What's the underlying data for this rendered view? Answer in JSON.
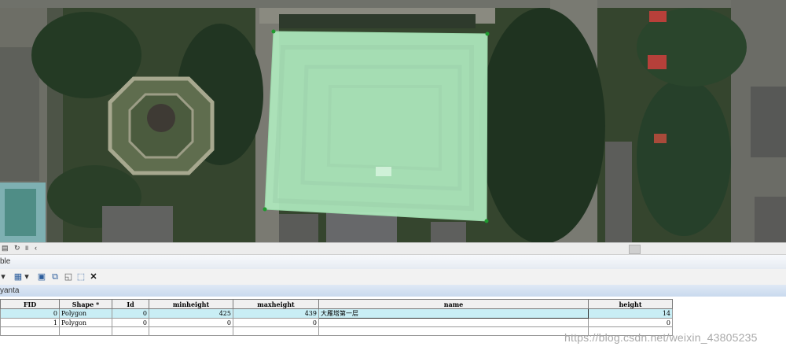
{
  "map": {
    "polygon_fill": "#aee8bd",
    "vertex_color": "#1f9a2f"
  },
  "map_strip": {
    "icons": [
      "page-icon",
      "refresh-icon",
      "pause-icon",
      "back-icon"
    ]
  },
  "panel": {
    "title": "ble"
  },
  "layer_tab": {
    "label": "yanta"
  },
  "toolbar": {
    "icons": [
      "table-options-icon",
      "select-by-attributes-icon",
      "switch-selection-icon",
      "clear-selection-icon",
      "zoom-to-selected-icon",
      "delete-selected-icon"
    ]
  },
  "table": {
    "columns": [
      "FID",
      "Shape *",
      "Id",
      "minheight",
      "maxheight",
      "name",
      "height"
    ],
    "rows": [
      {
        "fid": "0",
        "shape": "Polygon",
        "id": "0",
        "minheight": "425",
        "maxheight": "439",
        "name": "大雁塔第一层",
        "height": "14",
        "selected": true
      },
      {
        "fid": "1",
        "shape": "Polygon",
        "id": "0",
        "minheight": "0",
        "maxheight": "0",
        "name": "",
        "height": "0",
        "selected": false
      }
    ],
    "selected_color": "#c9eef5"
  },
  "watermark": "https://blog.csdn.net/weixin_43805235"
}
